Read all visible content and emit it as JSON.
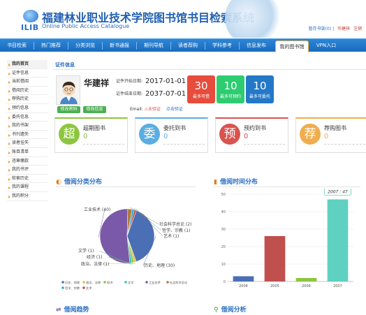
{
  "header": {
    "logo_text": "ILIB",
    "title": "福建林业职业技术学院图书馆书目检索系统",
    "subtitle": "Online Public Access Catalogue",
    "links": {
      "cart": "暂存书架(0)",
      "user": "华建祥",
      "logout": "注销"
    }
  },
  "nav": [
    {
      "label": "书目检索"
    },
    {
      "label": "热门推荐"
    },
    {
      "label": "分类浏览"
    },
    {
      "label": "新书通报"
    },
    {
      "label": "期刊导航"
    },
    {
      "label": "读者荐购"
    },
    {
      "label": "学科参考"
    },
    {
      "label": "信息发布"
    },
    {
      "label": "我的图书馆"
    },
    {
      "label": "VPN入口"
    }
  ],
  "sidebar": [
    {
      "label": "我的首页"
    },
    {
      "label": "证件信息"
    },
    {
      "label": "当前借阅"
    },
    {
      "label": "借阅历史"
    },
    {
      "label": "荐购历史"
    },
    {
      "label": "预约信息"
    },
    {
      "label": "委托信息"
    },
    {
      "label": "我的书架"
    },
    {
      "label": "书刊遗失"
    },
    {
      "label": "读者挂失"
    },
    {
      "label": "账目清单"
    },
    {
      "label": "违章缴款"
    },
    {
      "label": "我的书评"
    },
    {
      "label": "检索历史"
    },
    {
      "label": "我的课程"
    },
    {
      "label": "我的积分"
    }
  ],
  "profile": {
    "section_title": "证件信息",
    "name": "华建祥",
    "start_label": "证件开始日期:",
    "start_value": "2017-01-01",
    "end_label": "证件结束日期:",
    "end_value": "2037-07-01",
    "btn_password": "修改密码",
    "btn_info": "修改信息",
    "email_label": "Email:",
    "email_status": "未验证",
    "email_link": "点击验证"
  },
  "stats": [
    {
      "value": "30",
      "label": "最多可借",
      "color": "#e74c3c"
    },
    {
      "value": "10",
      "label": "最多可预约",
      "color": "#2ecc71"
    },
    {
      "value": "10",
      "label": "最多可委托",
      "color": "#2378c8"
    }
  ],
  "cards": [
    {
      "icon": "超",
      "title": "超期图书",
      "value": "0",
      "color": "#8dc63f"
    },
    {
      "icon": "委",
      "title": "委托到书",
      "value": "0",
      "color": "#5aaee0"
    },
    {
      "icon": "预",
      "title": "预约到书",
      "value": "0",
      "color": "#d9534f"
    },
    {
      "icon": "荐",
      "title": "荐购图书",
      "value": "0",
      "color": "#f0ad4e"
    }
  ],
  "panels": {
    "category": "借阅分类分布",
    "time": "借阅时间分布",
    "trend": "借阅趋势",
    "analysis": "借阅分析"
  },
  "chart_data": [
    {
      "type": "pie",
      "title": "借阅分类分布",
      "labels": [
        "历史、地理",
        "政治、法律",
        "经济",
        "文学",
        "工业技术",
        "社会科学总论",
        "哲学、宗教",
        "艺术"
      ],
      "values": [
        30,
        1,
        1,
        1,
        40,
        2,
        1,
        1
      ],
      "colors": [
        "#4a6fb5",
        "#e0c04a",
        "#8cc63f",
        "#3ec0b3",
        "#7a5aa8",
        "#b07a3a",
        "#2aa8d8",
        "#c0504d"
      ],
      "legend_position": "bottom"
    },
    {
      "type": "bar",
      "title": "借阅时间分布",
      "categories": [
        "2004",
        "2005",
        "2006",
        "2007"
      ],
      "values": [
        3,
        26,
        2,
        47
      ],
      "colors": [
        "#4a6fb5",
        "#c0504d",
        "#8cc63f",
        "#5fd1c1"
      ],
      "ylim": [
        0,
        50
      ],
      "yticks": [
        0,
        10,
        20,
        30,
        40,
        50
      ],
      "tooltip": "2007 : 47",
      "grid": true
    }
  ]
}
